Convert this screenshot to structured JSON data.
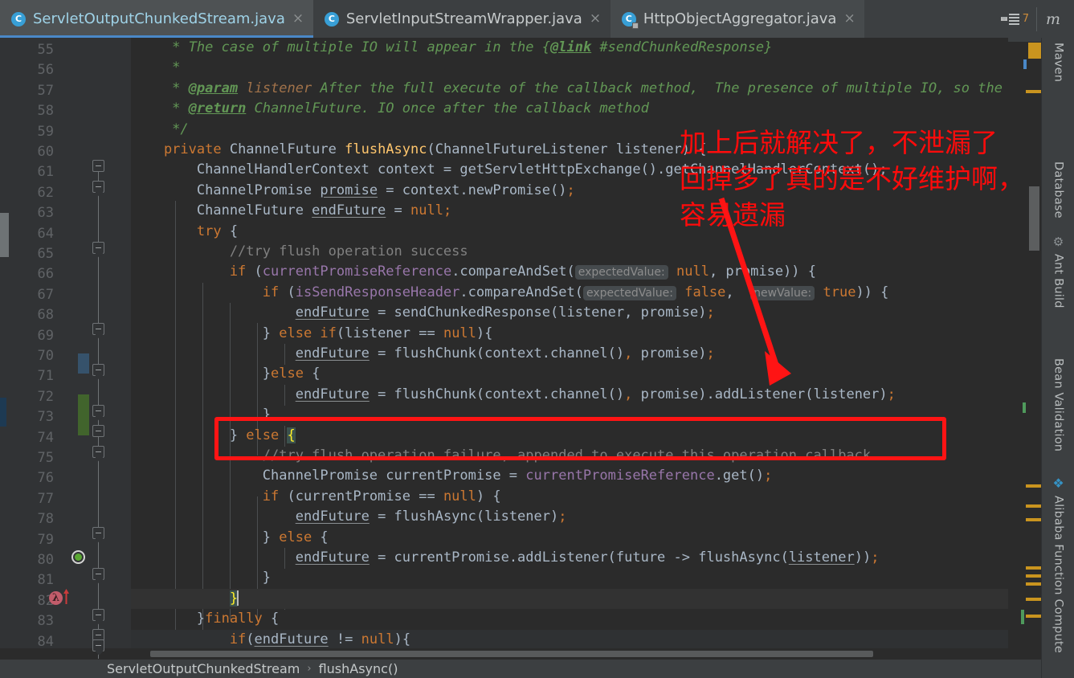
{
  "window": {
    "tab_list_count": "7",
    "maven_top_label": "m"
  },
  "tabs": [
    {
      "label": "ServletOutputChunkedStream.java",
      "icon": "java-class-icon",
      "close": "×",
      "active": true,
      "locked": false,
      "badge": "C"
    },
    {
      "label": "ServletInputStreamWrapper.java",
      "icon": "java-class-icon",
      "close": "×",
      "active": false,
      "locked": false,
      "badge": "C"
    },
    {
      "label": "HttpObjectAggregator.java",
      "icon": "java-class-readonly-icon",
      "close": "×",
      "active": false,
      "locked": true,
      "badge": "C"
    }
  ],
  "breadcrumb": {
    "class": "ServletOutputChunkedStream",
    "separator": "›",
    "method": "flushAsync()"
  },
  "annotations": {
    "color": "#ff0b0b",
    "lines": [
      "加上后就解决了，不泄漏了",
      "回掉多了真的是不好维护啊，",
      "容易遗漏"
    ],
    "highlight_box_line": "72"
  },
  "editor": {
    "first_line": 55,
    "last_line": 84,
    "line_numbers": [
      "55",
      "56",
      "57",
      "58",
      "59",
      "60",
      "61",
      "62",
      "63",
      "64",
      "65",
      "66",
      "67",
      "68",
      "69",
      "70",
      "71",
      "72",
      "73",
      "74",
      "75",
      "76",
      "77",
      "78",
      "79",
      "80",
      "81",
      "82",
      "83",
      "84"
    ],
    "lines": [
      {
        "n": "55",
        "text": "     * The case of multiple IO will appear in the {@link #sendChunkedResponse}"
      },
      {
        "n": "56",
        "text": "     *"
      },
      {
        "n": "57",
        "text": "     * @param listener After the full execute of the callback method,  The presence of multiple IO, so the"
      },
      {
        "n": "58",
        "text": "     * @return ChannelFuture. IO once after the callback method"
      },
      {
        "n": "59",
        "text": "     */"
      },
      {
        "n": "60",
        "text": "    private ChannelFuture flushAsync(ChannelFutureListener listener) {"
      },
      {
        "n": "61",
        "text": "        ChannelHandlerContext context = getServletHttpExchange().getChannelHandlerContext();"
      },
      {
        "n": "62",
        "text": "        ChannelPromise promise = context.newPromise();"
      },
      {
        "n": "63",
        "text": "        ChannelFuture endFuture = null;"
      },
      {
        "n": "64",
        "text": "        try {"
      },
      {
        "n": "65",
        "text": "            //try flush operation success"
      },
      {
        "n": "66",
        "text": "            if (currentPromiseReference.compareAndSet( expectedValue: null, promise)) {"
      },
      {
        "n": "67",
        "text": "                if (isSendResponseHeader.compareAndSet( expectedValue: false,  newValue: true)) {"
      },
      {
        "n": "68",
        "text": "                    endFuture = sendChunkedResponse(listener, promise);"
      },
      {
        "n": "69",
        "text": "                } else if(listener == null){"
      },
      {
        "n": "70",
        "text": "                    endFuture = flushChunk(context.channel(), promise);"
      },
      {
        "n": "71",
        "text": "                }else {"
      },
      {
        "n": "72",
        "text": "                    endFuture = flushChunk(context.channel(), promise).addListener(listener);"
      },
      {
        "n": "73",
        "text": "                }"
      },
      {
        "n": "74",
        "text": "            } else {"
      },
      {
        "n": "75",
        "text": "                //try flush operation failure, appended to execute this operation callback"
      },
      {
        "n": "76",
        "text": "                ChannelPromise currentPromise = currentPromiseReference.get();"
      },
      {
        "n": "77",
        "text": "                if (currentPromise == null) {"
      },
      {
        "n": "78",
        "text": "                    endFuture = flushAsync(listener);"
      },
      {
        "n": "79",
        "text": "                } else {"
      },
      {
        "n": "80",
        "text": "                    endFuture = currentPromise.addListener(future -> flushAsync(listener));"
      },
      {
        "n": "81",
        "text": "                }"
      },
      {
        "n": "82",
        "text": "            }"
      },
      {
        "n": "83",
        "text": "        }finally {"
      },
      {
        "n": "84",
        "text": "            if(endFuture != null){"
      }
    ],
    "inlay_hints": [
      "expectedValue:",
      "newValue:"
    ],
    "gutter_icons": [
      {
        "line": "78",
        "name": "recursive-call-icon"
      },
      {
        "line": "80",
        "name": "lambda-icon"
      }
    ],
    "vcs_markers": [
      {
        "line": "69",
        "kind": "modified",
        "color": "#36526b"
      },
      {
        "line": "71",
        "kind": "added",
        "color": "#41642c"
      }
    ]
  },
  "rightbar": {
    "items": [
      {
        "label": "Maven",
        "icon": "maven-icon"
      },
      {
        "label": "Database",
        "icon": "database-icon"
      },
      {
        "label": "Ant Build",
        "icon": "ant-icon"
      },
      {
        "label": "Bean Validation",
        "icon": "bean-icon"
      },
      {
        "label": "Alibaba Function Compute",
        "icon": "alibaba-fc-icon"
      }
    ]
  },
  "colors": {
    "bg": "#2b2b2b",
    "chrome": "#3c3f41",
    "gutter": "#313335",
    "tab_active_underline": "#4a88c7",
    "annotation_red": "#ff0b0b"
  }
}
